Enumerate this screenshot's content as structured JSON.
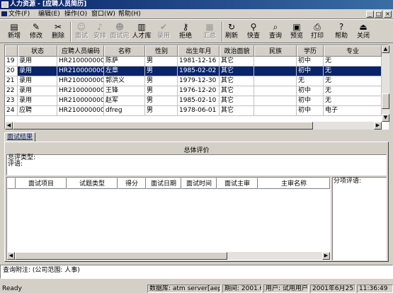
{
  "window": {
    "title": "人力资源 - [应聘人员简历]"
  },
  "menu": [
    "文件(F)",
    "编辑(E)",
    "操作(O)",
    "窗口(W)",
    "帮助(H)"
  ],
  "mdi_controls": [
    "_",
    "□",
    "×"
  ],
  "toolbar": [
    {
      "label": "新增",
      "icon": "new-doc-icon",
      "glyph": "▤",
      "enabled": true
    },
    {
      "label": "修改",
      "icon": "pencil-icon",
      "glyph": "✎",
      "enabled": true
    },
    {
      "label": "删除",
      "icon": "delete-icon",
      "glyph": "✂",
      "enabled": true
    },
    {
      "label": "面试",
      "icon": "interview-icon",
      "glyph": "☺",
      "enabled": false
    },
    {
      "label": "安排",
      "icon": "arrange-icon",
      "glyph": "♪",
      "enabled": false
    },
    {
      "label": "面试完",
      "icon": "interview-done-icon",
      "glyph": "☻",
      "enabled": false
    },
    {
      "label": "人才库",
      "icon": "talent-pool-icon",
      "glyph": "▥",
      "enabled": true
    },
    {
      "label": "录用",
      "icon": "check-icon",
      "glyph": "✔",
      "enabled": false
    },
    {
      "label": "拒绝",
      "icon": "key-icon",
      "glyph": "⚷",
      "enabled": true
    },
    {
      "label": "汇总",
      "icon": "summary-icon",
      "glyph": "▦",
      "enabled": false
    },
    {
      "label": "刷新",
      "icon": "refresh-icon",
      "glyph": "↻",
      "enabled": true
    },
    {
      "label": "快查",
      "icon": "quick-search-icon",
      "glyph": "⚲",
      "enabled": true
    },
    {
      "label": "查询",
      "icon": "query-icon",
      "glyph": "⌕",
      "enabled": true
    },
    {
      "label": "预览",
      "icon": "preview-icon",
      "glyph": "▣",
      "enabled": true
    },
    {
      "label": "打印",
      "icon": "printer-icon",
      "glyph": "⎙",
      "enabled": true
    },
    {
      "label": "帮助",
      "icon": "help-icon",
      "glyph": "?",
      "enabled": true
    },
    {
      "label": "关闭",
      "icon": "close-door-icon",
      "glyph": "⏏",
      "enabled": true
    }
  ],
  "grid": {
    "columns": [
      "状态",
      "应聘人员编码",
      "名称",
      "性别",
      "出生年月",
      "政治面貌",
      "民族",
      "学历",
      "专业"
    ],
    "rows": [
      {
        "n": "19",
        "cells": [
          "录用",
          "HR2100000000020",
          "陈萨",
          "男",
          "1981-12-16",
          "其它",
          "",
          "初中",
          "无"
        ]
      },
      {
        "n": "20",
        "cells": [
          "录用",
          "HR2100000000021",
          "左章",
          "男",
          "1985-02-02",
          "其它",
          "",
          "初中",
          "无"
        ],
        "selected": true
      },
      {
        "n": "21",
        "cells": [
          "录用",
          "HR2100000000022",
          "郭洪义",
          "男",
          "1979-12-30",
          "其它",
          "",
          "无",
          "无"
        ]
      },
      {
        "n": "22",
        "cells": [
          "录用",
          "HR2100000000023",
          "王锋",
          "男",
          "1976-12-20",
          "其它",
          "",
          "初中",
          "无"
        ]
      },
      {
        "n": "23",
        "cells": [
          "录用",
          "HR2100000000024",
          "赵军",
          "男",
          "1985-02-10",
          "其它",
          "",
          "初中",
          "无"
        ]
      },
      {
        "n": "24",
        "cells": [
          "应聘",
          "HR2100000000025",
          "dfreg",
          "男",
          "1978-06-01",
          "其它",
          "",
          "初中",
          "电子"
        ]
      }
    ]
  },
  "tab": {
    "label": "面试结果"
  },
  "summary": {
    "title": "总体评价",
    "type_label": "总评类型:",
    "comment_label": "评语:"
  },
  "interview_grid": {
    "columns": [
      "面试项目",
      "试题类型",
      "得分",
      "面试日期",
      "面试时间",
      "面试主审",
      "主审名称"
    ]
  },
  "item_comment_label": "分项评语:",
  "hint": "查询附注: (公司范围: 人事)",
  "status": {
    "ready": "Ready",
    "database": "数据库: atm server[aepew]",
    "period": "期间: 2001.6",
    "user": "用户: 试用用户",
    "date": "2001年6月25日",
    "time": "11:36:49"
  }
}
